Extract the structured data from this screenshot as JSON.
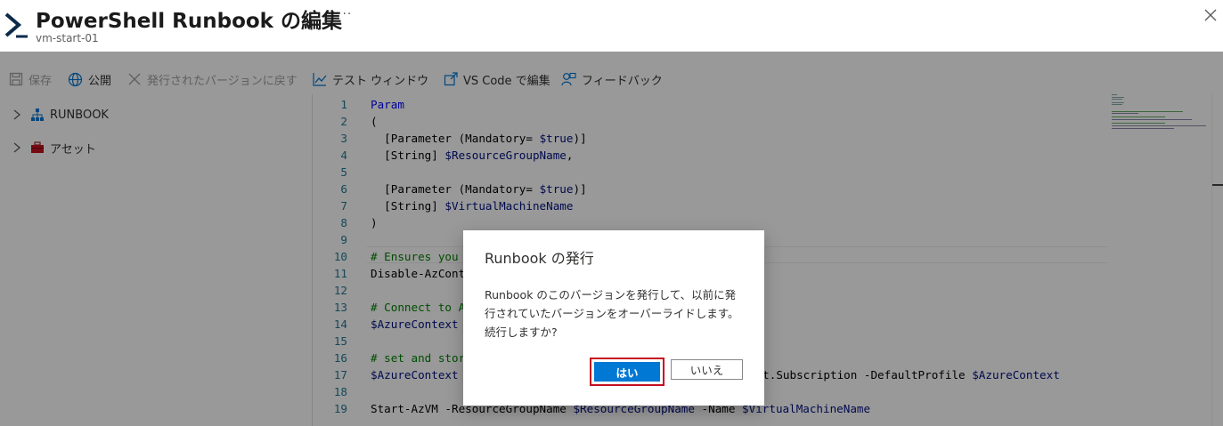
{
  "header": {
    "title": "PowerShell Runbook の編集",
    "more": "···",
    "subtitle": "vm-start-01"
  },
  "toolbar": {
    "save": "保存",
    "publish": "公開",
    "revert": "発行されたバージョンに戻す",
    "test_window": "テスト ウィンドウ",
    "vscode": "VS Code で編集",
    "feedback": "フィードバック"
  },
  "sidebar": {
    "items": [
      {
        "label": "RUNBOOK",
        "icon": "hierarchy-icon"
      },
      {
        "label": "アセット",
        "icon": "toolbox-icon"
      }
    ]
  },
  "editor": {
    "lines": [
      {
        "n": "1",
        "text": "Param"
      },
      {
        "n": "2",
        "text": "("
      },
      {
        "n": "3",
        "text": "  [Parameter (Mandatory= $true)]"
      },
      {
        "n": "4",
        "text": "  [String] $ResourceGroupName,"
      },
      {
        "n": "5",
        "text": ""
      },
      {
        "n": "6",
        "text": "  [Parameter (Mandatory= $true)]"
      },
      {
        "n": "7",
        "text": "  [String] $VirtualMachineName"
      },
      {
        "n": "8",
        "text": ")"
      },
      {
        "n": "9",
        "text": ""
      },
      {
        "n": "10",
        "text": "# Ensures you"
      },
      {
        "n": "11",
        "text": "Disable-AzCont"
      },
      {
        "n": "12",
        "text": ""
      },
      {
        "n": "13",
        "text": "# Connect to A"
      },
      {
        "n": "14",
        "text": "$AzureContext"
      },
      {
        "n": "15",
        "text": ""
      },
      {
        "n": "16",
        "text": "# set and stor"
      },
      {
        "n": "17",
        "text": "$AzureContext",
        "tail": "ext.Subscription -DefaultProfile $AzureContext"
      },
      {
        "n": "18",
        "text": ""
      },
      {
        "n": "19",
        "text": "Start-AzVM -ResourceGroupName $ResourceGroupName -Name $VirtualMachineName"
      }
    ]
  },
  "dialog": {
    "title": "Runbook の発行",
    "body": "Runbook のこのバージョンを発行して、以前に発行されていたバージョンをオーバーライドします。続行しますか?",
    "yes": "はい",
    "no": "いいえ"
  },
  "colors": {
    "accent": "#0078d4",
    "highlight_border": "#c50f1f"
  }
}
